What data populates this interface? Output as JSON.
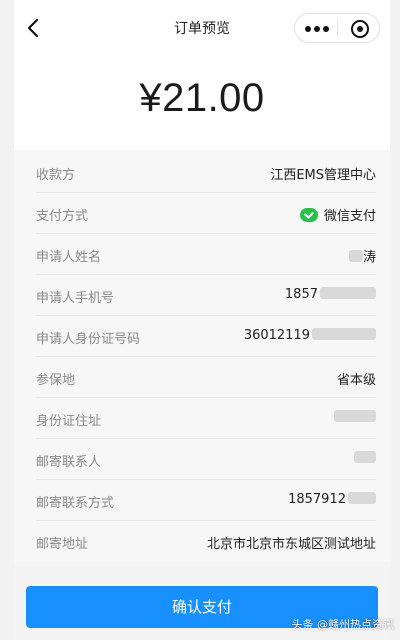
{
  "header": {
    "title": "订单预览",
    "back_icon": "chevron-left-icon",
    "more_icon": "more-dots-icon",
    "close_icon": "target-close-icon"
  },
  "amount": "¥21.00",
  "rows": [
    {
      "label": "收款方",
      "value": "江西EMS管理中心"
    },
    {
      "label": "支付方式",
      "value": "微信支付",
      "icon": "wechat-pay-icon",
      "icon_color": "#2bbf4a"
    },
    {
      "label": "申请人姓名",
      "value": "涛"
    },
    {
      "label": "申请人手机号",
      "value": "1857"
    },
    {
      "label": "申请人身份证号码",
      "value": "36012119"
    },
    {
      "label": "参保地",
      "value": "省本级"
    },
    {
      "label": "身份证住址",
      "value": ""
    },
    {
      "label": "邮寄联系人",
      "value": ""
    },
    {
      "label": "邮寄联系方式",
      "value": "1857912"
    },
    {
      "label": "邮寄地址",
      "value": "北京市北京市东城区测试地址"
    }
  ],
  "pay_button": {
    "label": "确认支付",
    "color": "#1890ff"
  },
  "watermark": "头条 @赣州热点资讯"
}
